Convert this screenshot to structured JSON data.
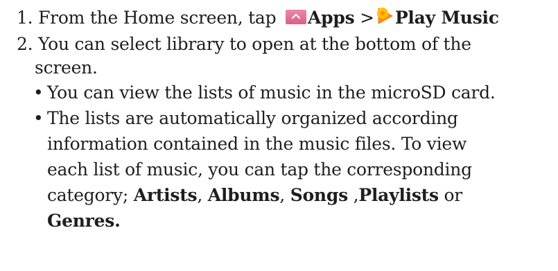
{
  "step1": {
    "number": "1.",
    "text": "From the Home screen, tap",
    "apps_icon": "apps-chevron-up-icon",
    "apps_label": "Apps",
    "separator": ">",
    "music_icon": "play-music-icon",
    "music_label": "Play Music"
  },
  "step2": {
    "number": "2.",
    "line1": "You can select library to open at the bottom of the",
    "line2": "screen."
  },
  "bullets": {
    "symbol": "•",
    "b1": "You can view the lists of music in the microSD card.",
    "b2_line1": "The lists are automatically organized according",
    "b2_line2": "information contained in the music files. To view",
    "b2_line3": "each list of music, you can tap the corresponding",
    "b2_line4_prefix": "category; ",
    "categories": {
      "artists": "Artists",
      "sep1": ", ",
      "albums": "Albums",
      "sep2": ", ",
      "songs": "Songs",
      "sep3": " ,",
      "playlists": "Playlists",
      "sep4": " or"
    },
    "b2_line5": "Genres."
  },
  "colors": {
    "text": "#1e1e1e",
    "apps_icon": "#e0698f",
    "music_icon_orange": "#ff8f00",
    "music_icon_yellow": "#ffc107"
  }
}
